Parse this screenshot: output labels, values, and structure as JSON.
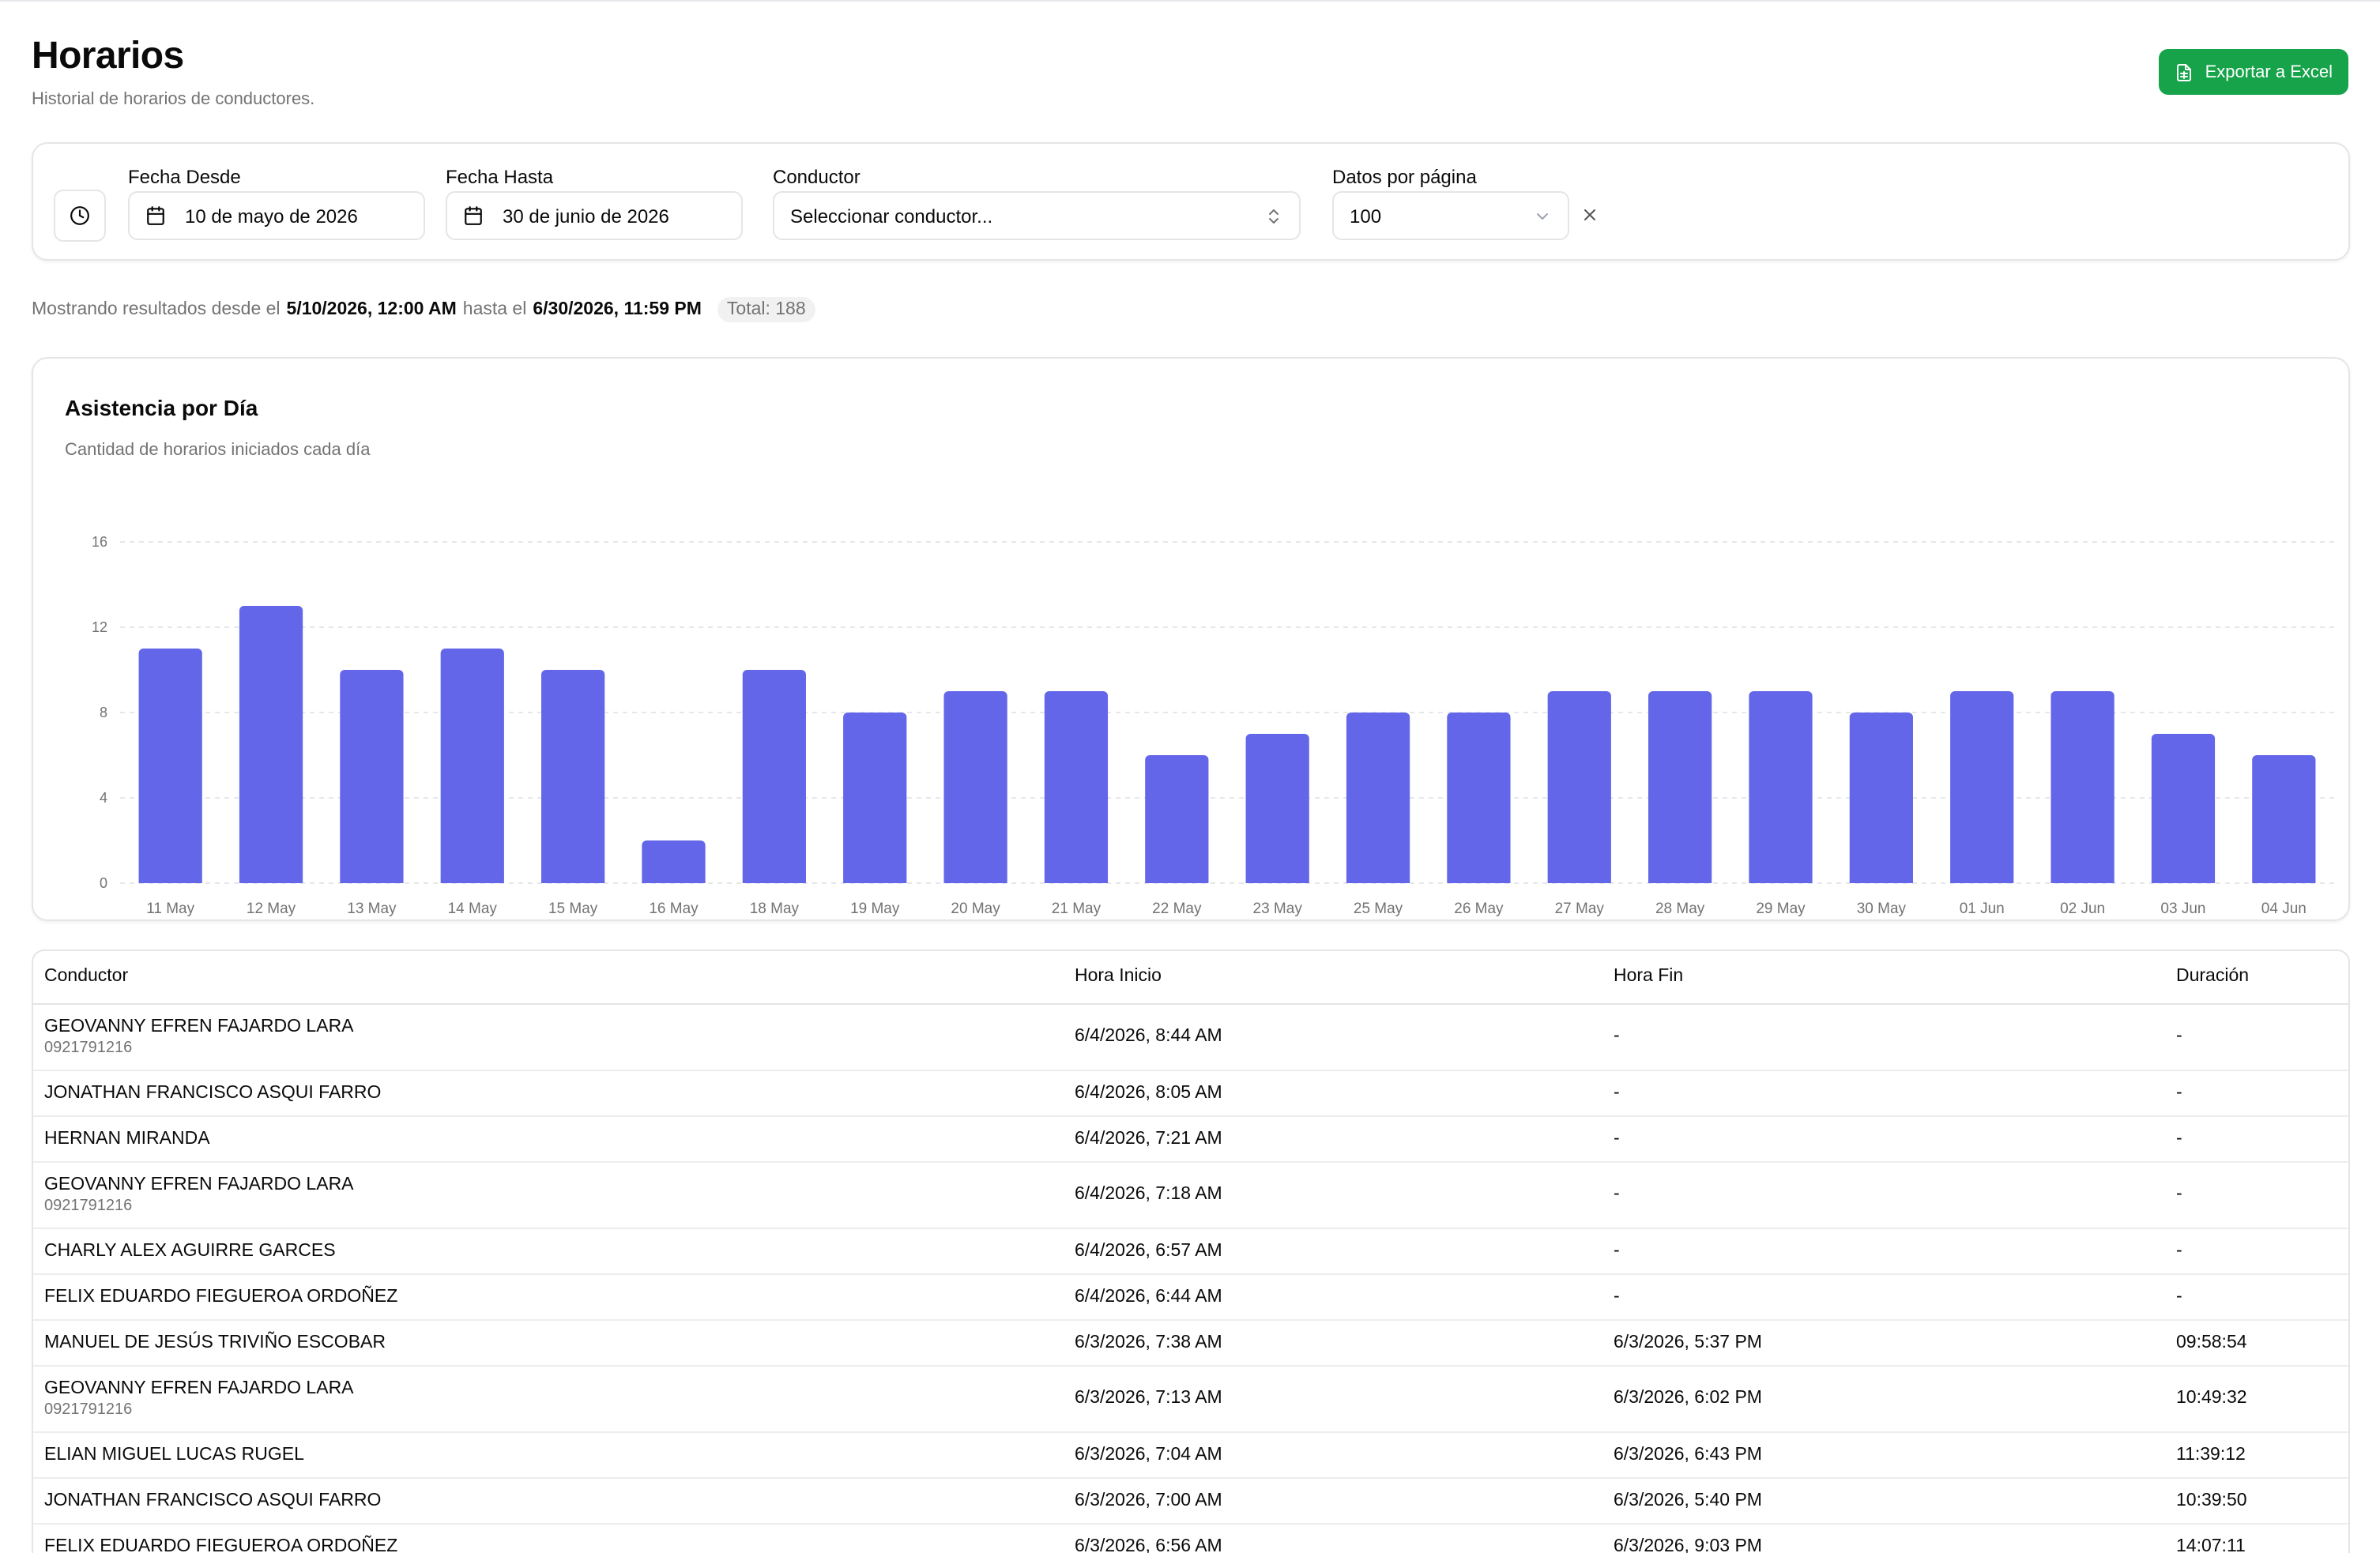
{
  "header": {
    "title": "Horarios",
    "subtitle": "Historial de horarios de conductores.",
    "export_label": "Exportar a Excel"
  },
  "filters": {
    "fecha_desde_label": "Fecha Desde",
    "fecha_desde_value": "10 de mayo de 2026",
    "fecha_hasta_label": "Fecha Hasta",
    "fecha_hasta_value": "30 de junio de 2026",
    "conductor_label": "Conductor",
    "conductor_placeholder": "Seleccionar conductor...",
    "per_page_label": "Datos por página",
    "per_page_value": "100"
  },
  "summary": {
    "prefix": "Mostrando resultados desde el",
    "from": "5/10/2026, 12:00 AM",
    "middle": "hasta el",
    "to": "6/30/2026, 11:59 PM",
    "total": "Total: 188"
  },
  "chart": {
    "title": "Asistencia por Día",
    "subtitle": "Cantidad de horarios iniciados cada día"
  },
  "chart_data": {
    "type": "bar",
    "categories": [
      "11 May",
      "12 May",
      "13 May",
      "14 May",
      "15 May",
      "16 May",
      "18 May",
      "19 May",
      "20 May",
      "21 May",
      "22 May",
      "23 May",
      "25 May",
      "26 May",
      "27 May",
      "28 May",
      "29 May",
      "30 May",
      "01 Jun",
      "02 Jun",
      "03 Jun",
      "04 Jun"
    ],
    "values": [
      11,
      13,
      10,
      11,
      10,
      2,
      10,
      8,
      9,
      9,
      6,
      7,
      8,
      8,
      9,
      9,
      9,
      8,
      9,
      9,
      7,
      6
    ],
    "yticks": [
      0,
      4,
      8,
      12,
      16
    ],
    "ylim": [
      0,
      16
    ],
    "grid": true,
    "bar_color": "#6366e8"
  },
  "table": {
    "columns": [
      "Conductor",
      "Hora Inicio",
      "Hora Fin",
      "Duración"
    ],
    "rows": [
      {
        "name": "GEOVANNY EFREN FAJARDO LARA",
        "id": "0921791216",
        "inicio": "6/4/2026, 8:44 AM",
        "fin": "-",
        "duracion": "-"
      },
      {
        "name": "JONATHAN FRANCISCO ASQUI FARRO",
        "id": "",
        "inicio": "6/4/2026, 8:05 AM",
        "fin": "-",
        "duracion": "-"
      },
      {
        "name": "HERNAN MIRANDA",
        "id": "",
        "inicio": "6/4/2026, 7:21 AM",
        "fin": "-",
        "duracion": "-"
      },
      {
        "name": "GEOVANNY EFREN FAJARDO LARA",
        "id": "0921791216",
        "inicio": "6/4/2026, 7:18 AM",
        "fin": "-",
        "duracion": "-"
      },
      {
        "name": "CHARLY ALEX AGUIRRE GARCES",
        "id": "",
        "inicio": "6/4/2026, 6:57 AM",
        "fin": "-",
        "duracion": "-"
      },
      {
        "name": "FELIX EDUARDO FIEGUEROA ORDOÑEZ",
        "id": "",
        "inicio": "6/4/2026, 6:44 AM",
        "fin": "-",
        "duracion": "-"
      },
      {
        "name": "MANUEL DE JESÚS TRIVIÑO ESCOBAR",
        "id": "",
        "inicio": "6/3/2026, 7:38 AM",
        "fin": "6/3/2026, 5:37 PM",
        "duracion": "09:58:54"
      },
      {
        "name": "GEOVANNY EFREN FAJARDO LARA",
        "id": "0921791216",
        "inicio": "6/3/2026, 7:13 AM",
        "fin": "6/3/2026, 6:02 PM",
        "duracion": "10:49:32"
      },
      {
        "name": "ELIAN MIGUEL LUCAS RUGEL",
        "id": "",
        "inicio": "6/3/2026, 7:04 AM",
        "fin": "6/3/2026, 6:43 PM",
        "duracion": "11:39:12"
      },
      {
        "name": "JONATHAN FRANCISCO ASQUI FARRO",
        "id": "",
        "inicio": "6/3/2026, 7:00 AM",
        "fin": "6/3/2026, 5:40 PM",
        "duracion": "10:39:50"
      },
      {
        "name": "FELIX EDUARDO FIEGUEROA ORDOÑEZ",
        "id": "",
        "inicio": "6/3/2026, 6:56 AM",
        "fin": "6/3/2026, 9:03 PM",
        "duracion": "14:07:11"
      }
    ]
  }
}
